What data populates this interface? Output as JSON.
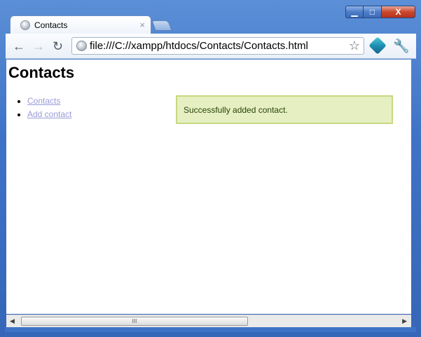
{
  "browser": {
    "tab_title": "Contacts",
    "tab_close": "×",
    "url": "file:///C://xampp/htdocs/Contacts/Contacts.html"
  },
  "window_controls": {
    "minimize": "▁",
    "maximize": "□",
    "close": "X"
  },
  "toolbar": {
    "back": "←",
    "forward": "→",
    "reload": "↻",
    "star": "☆",
    "wrench": "🔧"
  },
  "page": {
    "heading": "Contacts",
    "nav": [
      {
        "label": "Contacts"
      },
      {
        "label": "Add contact"
      }
    ],
    "notice": "Successfully added contact."
  },
  "scrollbar": {
    "left_arrow": "◀",
    "right_arrow": "▶",
    "grip": "III"
  }
}
